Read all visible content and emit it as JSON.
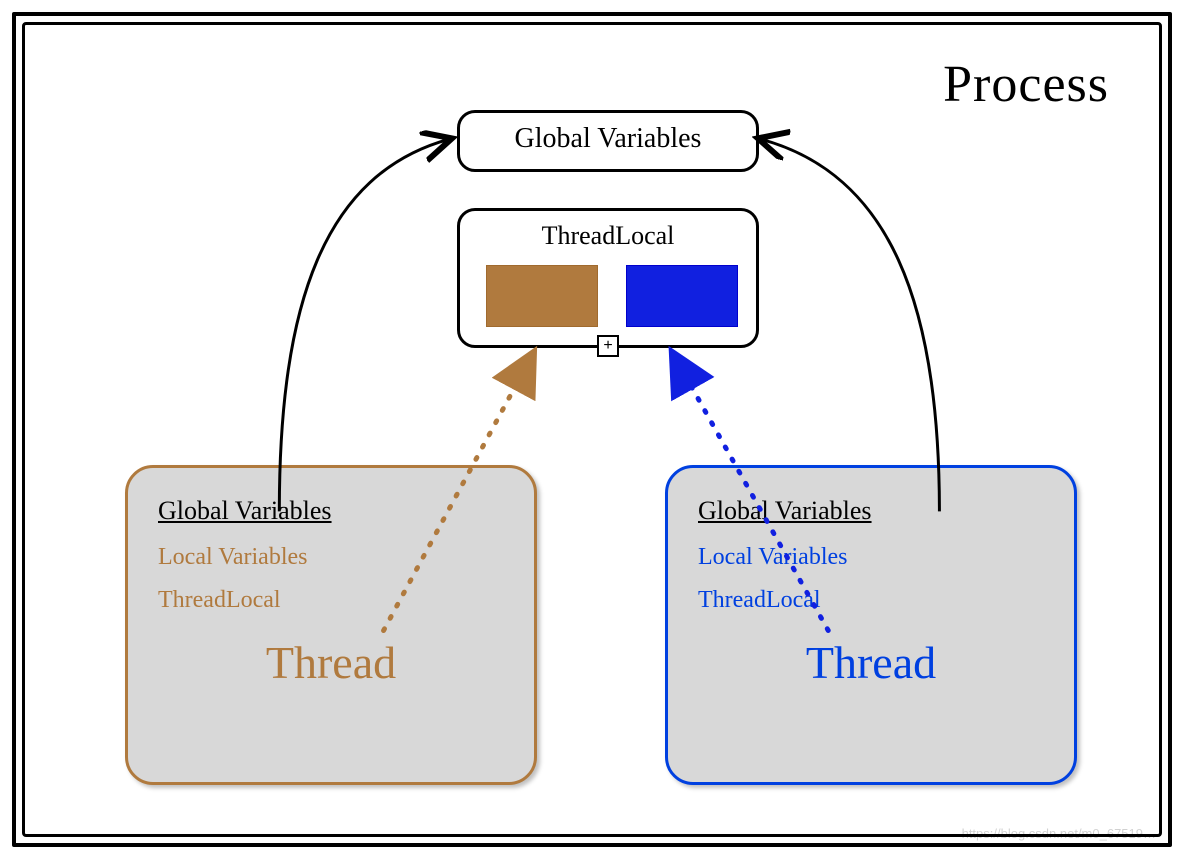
{
  "process": {
    "title": "Process"
  },
  "global_box": {
    "label": "Global Variables"
  },
  "threadlocal_box": {
    "label": "ThreadLocal",
    "expand_symbol": "+",
    "slots": {
      "brown": "#b07a3e",
      "blue": "#1120e0"
    }
  },
  "threads": {
    "brown": {
      "global_vars": "Global Variables",
      "local_vars": "Local Variables",
      "threadlocal": "ThreadLocal",
      "title": "Thread",
      "border_color": "#b07a3e"
    },
    "blue": {
      "global_vars": "Global Variables",
      "local_vars": "Local Variables",
      "threadlocal": "ThreadLocal",
      "title": "Thread",
      "border_color": "#0040e0"
    }
  },
  "watermark": "https://blog.csdn.net/m0_67519…"
}
